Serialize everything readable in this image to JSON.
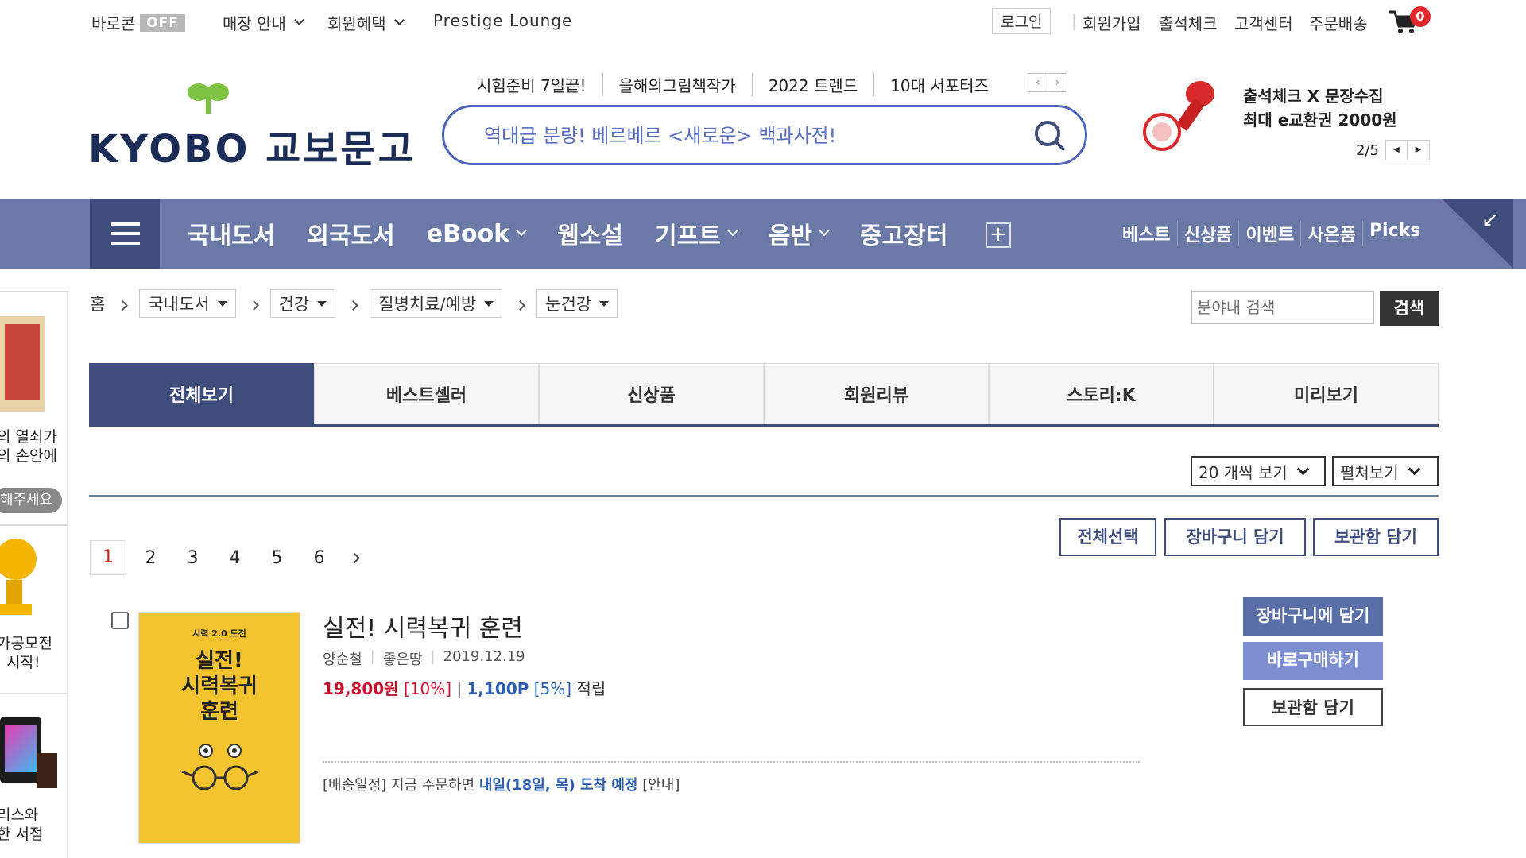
{
  "util": {
    "baroon": "바로콘",
    "off": "OFF",
    "store": "매장 안내",
    "benefits": "회원혜택",
    "lounge": "Prestige Lounge",
    "login": "로그인",
    "join": "회원가입",
    "attendance": "출석체크",
    "cs": "고객센터",
    "delivery": "주문배송",
    "cart_count": "0"
  },
  "header": {
    "logo": "KYOBO 교보문고",
    "keywords": [
      "시험준비 7일끝!",
      "올해의그림책작가",
      "2022 트렌드",
      "10대 서포터즈"
    ],
    "search_placeholder": "역대급 분량! 베르베르 <새로운> 백과사전!",
    "promo_line1": "출석체크 X 문장수집",
    "promo_line2": "최대 e교환권 2000원",
    "promo_page": "2/5"
  },
  "nav": {
    "items": [
      "국내도서",
      "외국도서",
      "eBook",
      "웹소설",
      "기프트",
      "음반",
      "중고장터"
    ],
    "right": [
      "베스트",
      "신상품",
      "이벤트",
      "사은품",
      "Picks"
    ]
  },
  "rail": {
    "ad1_line1": "의 열쇠가",
    "ad1_line2": "의 손안에",
    "ad1_pill": "해주세요",
    "ad2_line1": "가공모전",
    "ad2_line2": "· 시작!",
    "ad3_line1": "리스와",
    "ad3_line2": "한 서점"
  },
  "breadcrumb": {
    "home": "홈",
    "levels": [
      "국내도서",
      "건강",
      "질병치료/예방",
      "눈건강"
    ],
    "search_placeholder": "분야내 검색",
    "search_btn": "검색"
  },
  "tabs": [
    "전체보기",
    "베스트셀러",
    "신상품",
    "회원리뷰",
    "스토리:K",
    "미리보기"
  ],
  "list": {
    "per_page": "20 개씩 보기",
    "view_mode": "펼쳐보기",
    "select_all": "전체선택",
    "add_cart": "장바구니 담기",
    "add_wish": "보관함 담기",
    "pages": [
      "1",
      "2",
      "3",
      "4",
      "5",
      "6"
    ]
  },
  "product": {
    "cover_top": "시력 2.0 도전",
    "cover_title1": "실전!",
    "cover_title2": "시력복귀",
    "cover_title3": "훈련",
    "title": "실전! 시력복귀 훈련",
    "author": "양순철",
    "publisher": "좋은땅",
    "date": "2019.12.19",
    "price": "19,800원",
    "discount": "[10%]",
    "points": "1,100P",
    "points_rate": "[5%]",
    "points_label": "적립",
    "ship_prefix": "[배송일정] 지금 주문하면",
    "ship_date": "내일(18일, 목) 도착 예정",
    "ship_info": "[안내]",
    "btn_cart": "장바구니에 담기",
    "btn_buy": "바로구매하기",
    "btn_wish": "보관함 담기"
  },
  "colors": {
    "nav_bg": "#6a79a6",
    "nav_dark": "#3f4d7a",
    "search_border": "#4d64b6",
    "price_red": "#c8102e",
    "point_blue": "#2a5db0"
  }
}
